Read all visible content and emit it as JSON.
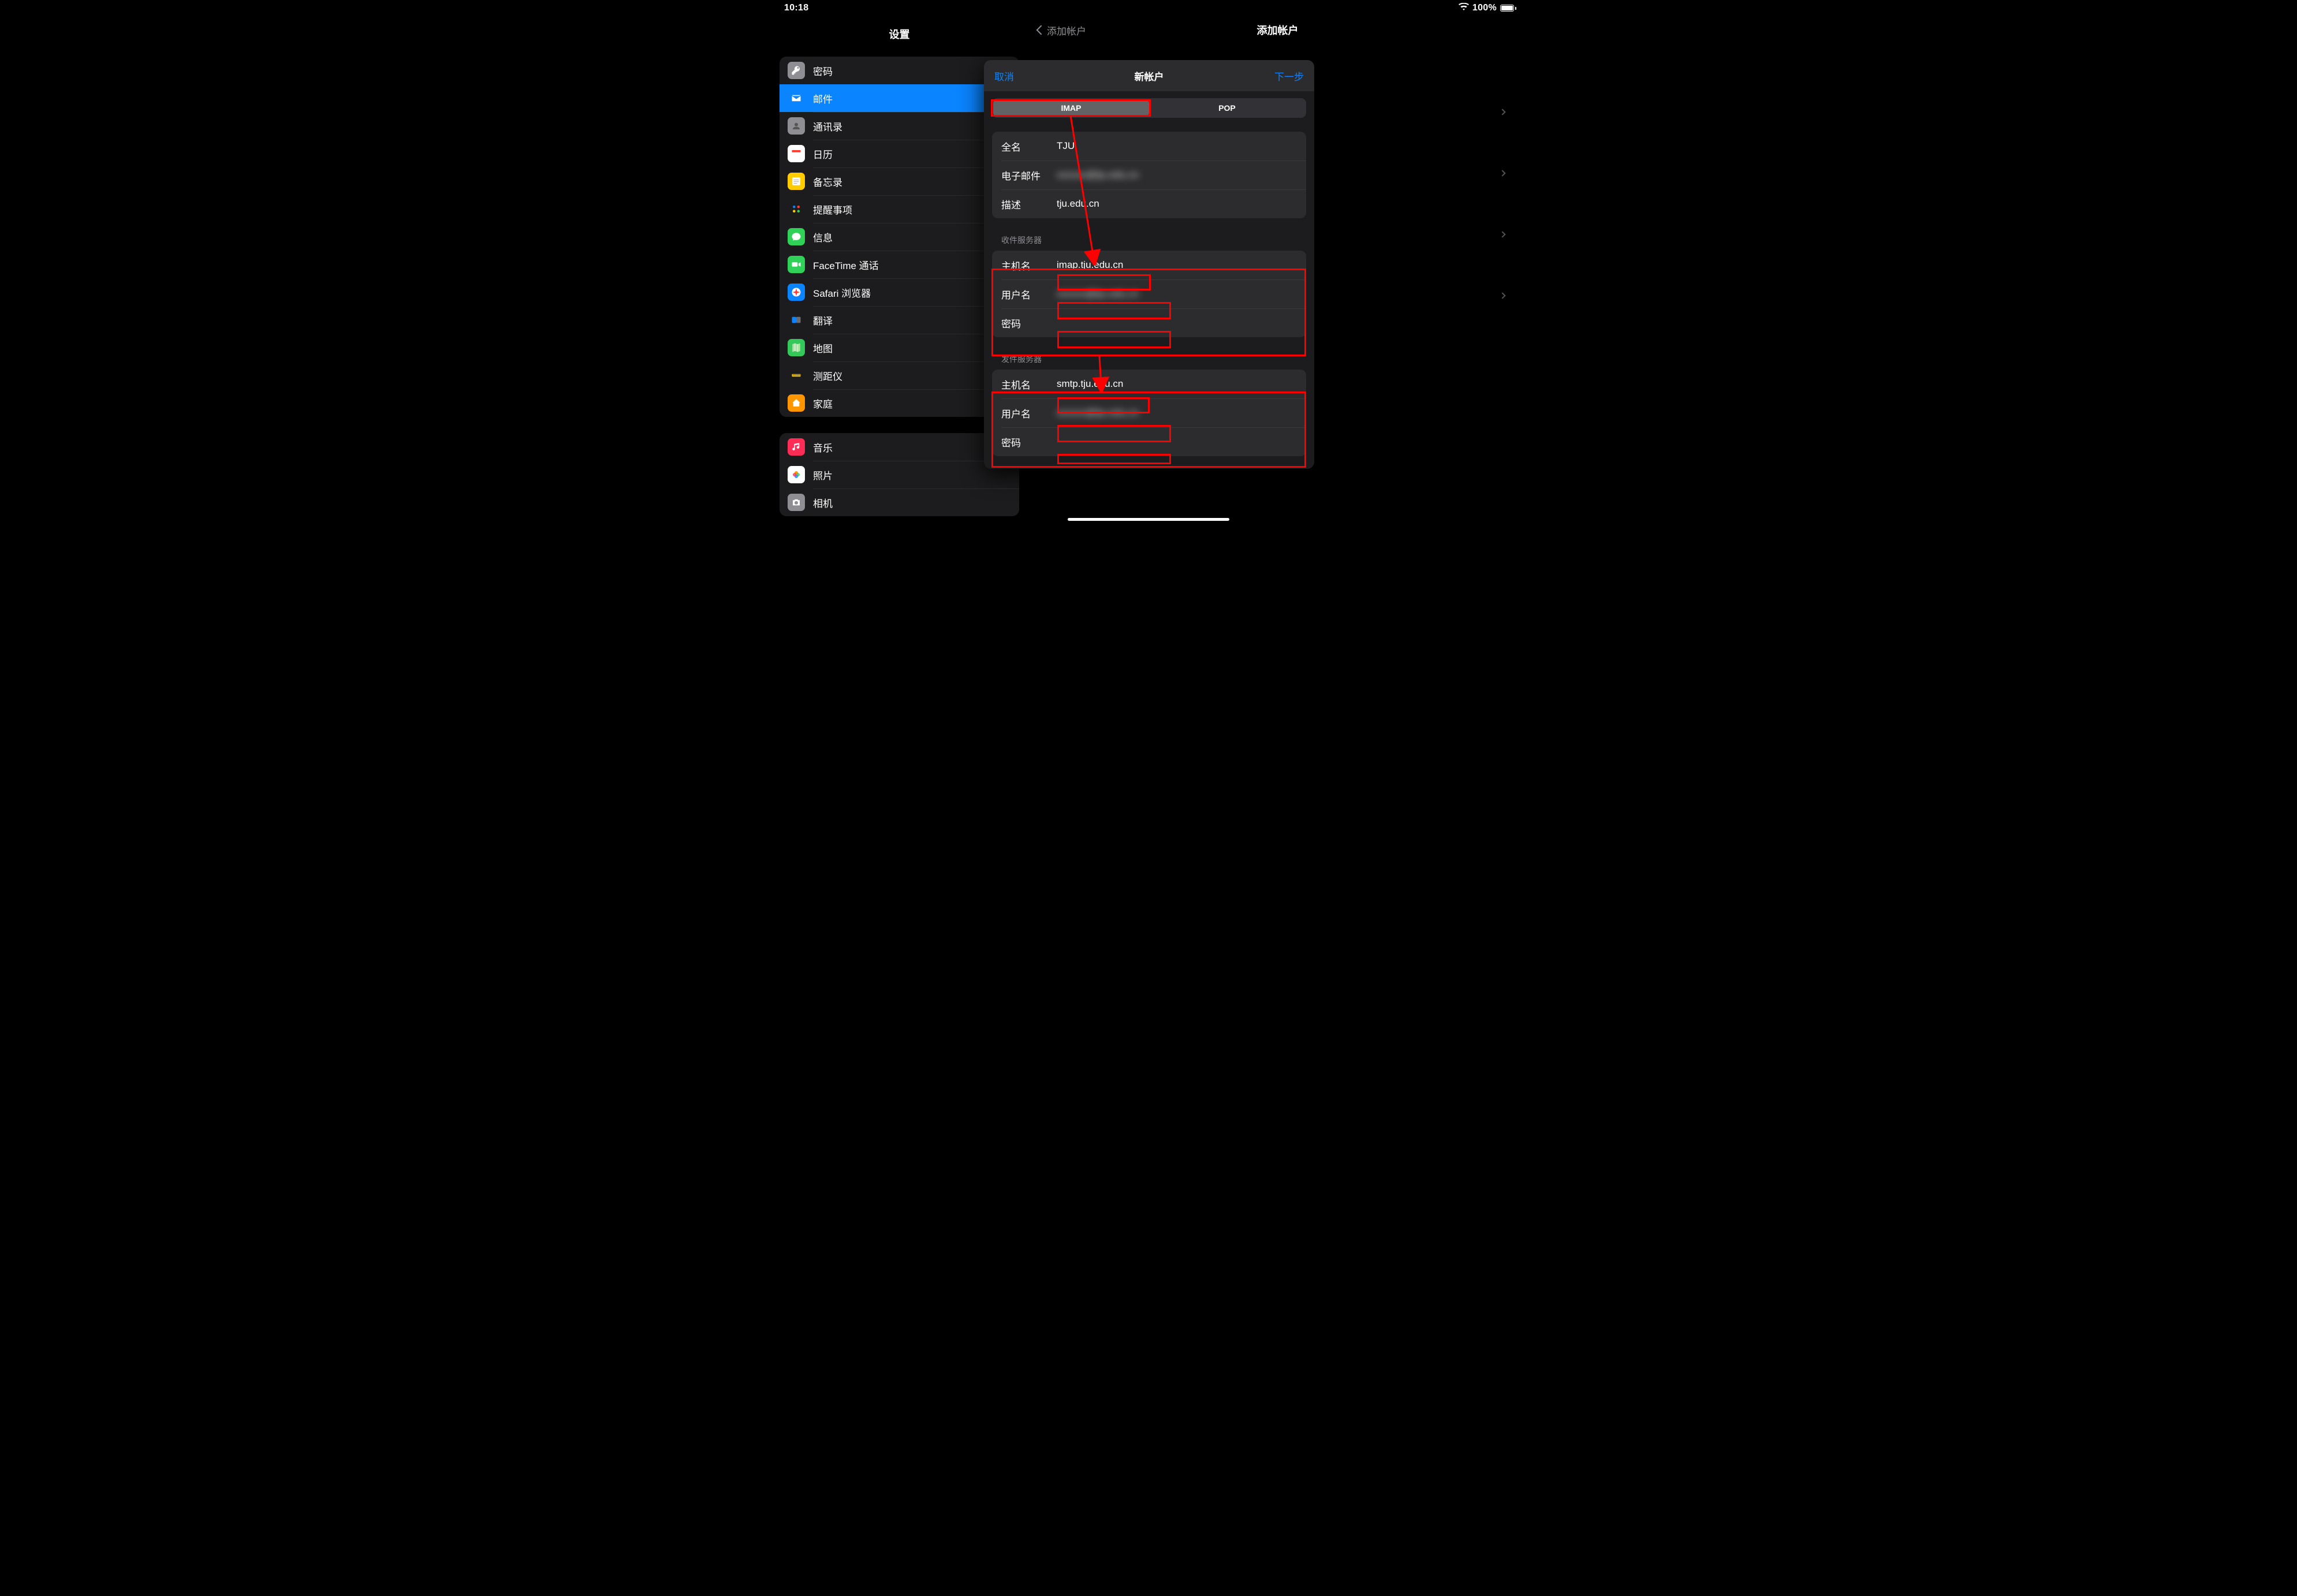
{
  "status": {
    "time": "10:18",
    "battery_pct": "100%"
  },
  "sidebar": {
    "title": "设置",
    "group1": [
      {
        "label": "密码",
        "icon_name": "key-icon",
        "bg": "#8e8e93"
      },
      {
        "label": "邮件",
        "icon_name": "mail-icon",
        "bg": "#0a84ff",
        "selected": true
      },
      {
        "label": "通讯录",
        "icon_name": "contacts-icon",
        "bg": "#8e8e93"
      },
      {
        "label": "日历",
        "icon_name": "calendar-icon",
        "bg": "#ffffff"
      },
      {
        "label": "备忘录",
        "icon_name": "notes-icon",
        "bg": "#ffcc00"
      },
      {
        "label": "提醒事项",
        "icon_name": "reminders-icon",
        "bg": "#1c1c1e"
      },
      {
        "label": "信息",
        "icon_name": "messages-icon",
        "bg": "#30d158"
      },
      {
        "label": "FaceTime 通话",
        "icon_name": "facetime-icon",
        "bg": "#30d158"
      },
      {
        "label": "Safari 浏览器",
        "icon_name": "safari-icon",
        "bg": "#0a84ff"
      },
      {
        "label": "翻译",
        "icon_name": "translate-icon",
        "bg": "#1c1c1e"
      },
      {
        "label": "地图",
        "icon_name": "maps-icon",
        "bg": "#34c759"
      },
      {
        "label": "测距仪",
        "icon_name": "measure-icon",
        "bg": "#1c1c1e"
      },
      {
        "label": "家庭",
        "icon_name": "home-icon",
        "bg": "#ff9500"
      }
    ],
    "group2": [
      {
        "label": "音乐",
        "icon_name": "music-icon",
        "bg": "#ff2d55"
      },
      {
        "label": "照片",
        "icon_name": "photos-icon",
        "bg": "#ffffff"
      },
      {
        "label": "相机",
        "icon_name": "camera-icon",
        "bg": "#8e8e93"
      }
    ]
  },
  "detail": {
    "back_label": "添加帐户",
    "title": "添加帐户"
  },
  "modal": {
    "cancel": "取消",
    "title": "新帐户",
    "next": "下一步",
    "segments": {
      "imap": "IMAP",
      "pop": "POP"
    },
    "account": {
      "full_name_label": "全名",
      "full_name_value": "TJU",
      "email_label": "电子邮件",
      "email_value": "xxxxxx@tju.edu.cn",
      "desc_label": "描述",
      "desc_value": "tju.edu.cn"
    },
    "incoming": {
      "title": "收件服务器",
      "host_label": "主机名",
      "host_value": "imap.tju.edu.cn",
      "user_label": "用户名",
      "user_value": "xxxxxx@tju.edu.cn",
      "pass_label": "密码",
      "pass_value": ""
    },
    "outgoing": {
      "title": "发件服务器",
      "host_label": "主机名",
      "host_value": "smtp.tju.edu.cn",
      "user_label": "用户名",
      "user_value": "xxxxxx@tju.edu.cn",
      "pass_label": "密码",
      "pass_value": ""
    }
  }
}
